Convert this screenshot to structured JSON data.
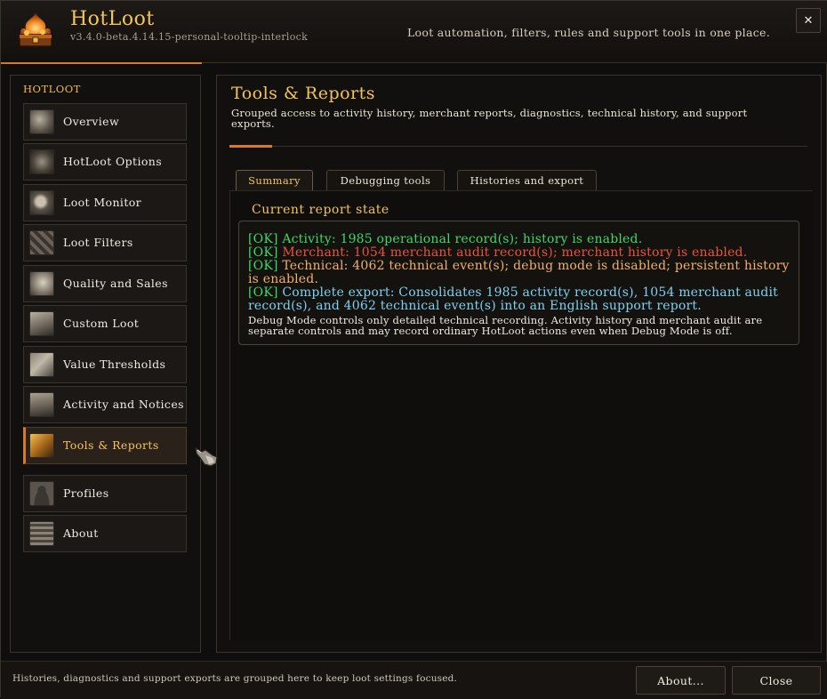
{
  "window": {
    "app_title": "HotLoot",
    "version": "v3.4.0-beta.4.14.15-personal-tooltip-interlock",
    "tagline": "Loot automation, filters, rules and support tools in one place.",
    "close_glyph": "✕"
  },
  "sidebar": {
    "heading": "HOTLOOT",
    "items": [
      {
        "label": "Overview",
        "icon": "overview-icon",
        "active": false
      },
      {
        "label": "HotLoot Options",
        "icon": "options-gear-icon",
        "active": false
      },
      {
        "label": "Loot Monitor",
        "icon": "loot-monitor-icon",
        "active": false
      },
      {
        "label": "Loot Filters",
        "icon": "loot-filters-icon",
        "active": false
      },
      {
        "label": "Quality and Sales",
        "icon": "quality-sales-icon",
        "active": false
      },
      {
        "label": "Custom Loot",
        "icon": "custom-loot-icon",
        "active": false
      },
      {
        "label": "Value Thresholds",
        "icon": "value-thresholds-icon",
        "active": false
      },
      {
        "label": "Activity and Notices",
        "icon": "activity-notices-icon",
        "active": false
      },
      {
        "label": "Tools & Reports",
        "icon": "tools-reports-icon",
        "active": true
      },
      {
        "label": "Profiles",
        "icon": "profiles-icon",
        "active": false
      },
      {
        "label": "About",
        "icon": "about-icon",
        "active": false
      }
    ]
  },
  "main": {
    "title": "Tools & Reports",
    "subtitle": "Grouped access to activity history, merchant reports, diagnostics, technical history, and support exports.",
    "tabs": [
      {
        "label": "Summary",
        "active": true
      },
      {
        "label": "Debugging tools",
        "active": false
      },
      {
        "label": "Histories and export",
        "active": false
      }
    ],
    "section_title": "Current report state",
    "report": {
      "lines": [
        {
          "tag": "[OK]",
          "text": "Activity: 1985 operational record(s); history is enabled."
        },
        {
          "tag": "[OK]",
          "text": "Merchant: 1054 merchant audit record(s); merchant history is enabled."
        },
        {
          "tag": "[OK]",
          "text": "Technical: 4062 technical event(s); debug mode is disabled; persistent history is enabled."
        },
        {
          "tag": "[OK]",
          "text": "Complete export: Consolidates 1985 activity record(s), 1054 merchant audit record(s), and 4062 technical event(s) into an English support report."
        }
      ],
      "note": "Debug Mode controls only detailed technical recording. Activity history and merchant audit are separate controls and may record ordinary HotLoot actions even when Debug Mode is off."
    }
  },
  "footer": {
    "hint": "Histories, diagnostics and support exports are grouped here to keep loot settings focused.",
    "about_button": "About...",
    "close_button": "Close"
  },
  "colors": {
    "accent_orange": "#d77a28",
    "title_gold": "#f2c55a",
    "ok_green": "#3fd66a",
    "merchant_red": "#e8543c",
    "technical_orange": "#f2b06a",
    "export_cyan": "#7fd0f0"
  }
}
